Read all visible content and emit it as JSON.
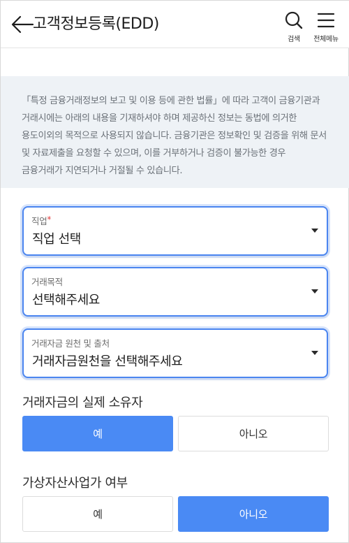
{
  "header": {
    "title": "고객정보등록(EDD)",
    "back_icon": "arrow-left-icon",
    "actions": [
      {
        "icon": "search-icon",
        "label": "검색"
      },
      {
        "icon": "hamburger-menu-icon",
        "label": "전체메뉴"
      }
    ]
  },
  "notice": {
    "text": "「특정 금융거래정보의 보고 및 이용 등에 관한 법률」에 따라 고객이 금융기관과 거래시에는 아래의 내용을 기재하셔야 하며 제공하신 정보는 동법에 의거한 용도이외의 목적으로 사용되지 않습니다. 금융기관은 정보확인 및 검증을 위해 문서 및 자료제출을 요청할 수 있으며, 이를 거부하거나 검증이 불가능한 경우 금융거래가 지연되거나 거절될 수 있습니다."
  },
  "fields": {
    "job": {
      "label": "직업",
      "required_mark": "*",
      "value": "직업 선택"
    },
    "purpose": {
      "label": "거래목적",
      "value": "선택해주세요"
    },
    "source": {
      "label": "거래자금 원천 및 출처",
      "value": "거래자금원천을 선택해주세요"
    }
  },
  "sections": {
    "owner": {
      "title": "거래자금의 실제 소유자",
      "yes": "예",
      "no": "아니오",
      "selected": "yes"
    },
    "vasp": {
      "title": "가상자산사업가 여부",
      "yes": "예",
      "no": "아니오",
      "selected": "no"
    }
  },
  "colors": {
    "accent": "#4a8af4",
    "notice_bg": "#eef2f6",
    "required": "#e23b3b"
  }
}
